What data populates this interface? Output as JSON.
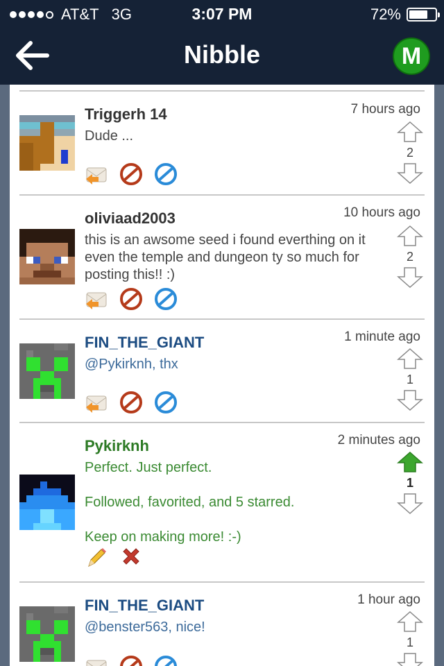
{
  "status": {
    "carrier": "AT&T",
    "network": "3G",
    "time": "3:07 PM",
    "battery": "72%",
    "battery_level": 0.72,
    "signal_bars_filled": 4,
    "signal_bars_total": 5
  },
  "nav": {
    "title": "Nibble",
    "back_icon": "back-arrow-icon",
    "menu_letter": "M"
  },
  "comments": [
    {
      "username": "Triggerh 14",
      "time": "7 hours ago",
      "text": "Dude ...",
      "votes": "2",
      "upvoted": false,
      "actions": [
        "reply-icon",
        "block-icon",
        "report-icon"
      ]
    },
    {
      "username": "oliviaad2003",
      "time": "10 hours ago",
      "text": "this is an awsome seed i found everthing on it even the temple and dungeon ty so much for posting this!! :)",
      "votes": "2",
      "upvoted": false,
      "actions": [
        "reply-icon",
        "block-icon",
        "report-icon"
      ]
    },
    {
      "username": "FIN_THE_GIANT",
      "time": "1 minute ago",
      "text": "@Pykirknh, thx",
      "votes": "1",
      "upvoted": false,
      "actions": [
        "reply-icon",
        "block-icon",
        "report-icon"
      ]
    },
    {
      "username": "Pykirknh",
      "time": "2 minutes ago",
      "text": "Perfect. Just perfect.\n\nFollowed, favorited, and 5 starred.\n\nKeep on making more! :-)",
      "votes": "1",
      "upvoted": true,
      "actions": [
        "edit-icon",
        "delete-icon"
      ]
    },
    {
      "username": "FIN_THE_GIANT",
      "time": "1 hour ago",
      "text": "@benster563, nice!",
      "votes": "1",
      "upvoted": false,
      "actions": [
        "reply-icon",
        "block-icon",
        "report-icon"
      ]
    }
  ],
  "colors": {
    "topbar": "#152236",
    "name_default": "#333333",
    "name_blue": "#1c4c82",
    "name_green": "#2c7a24",
    "upvote_active": "#3ca62e",
    "menu_button": "#1f9c1f"
  }
}
